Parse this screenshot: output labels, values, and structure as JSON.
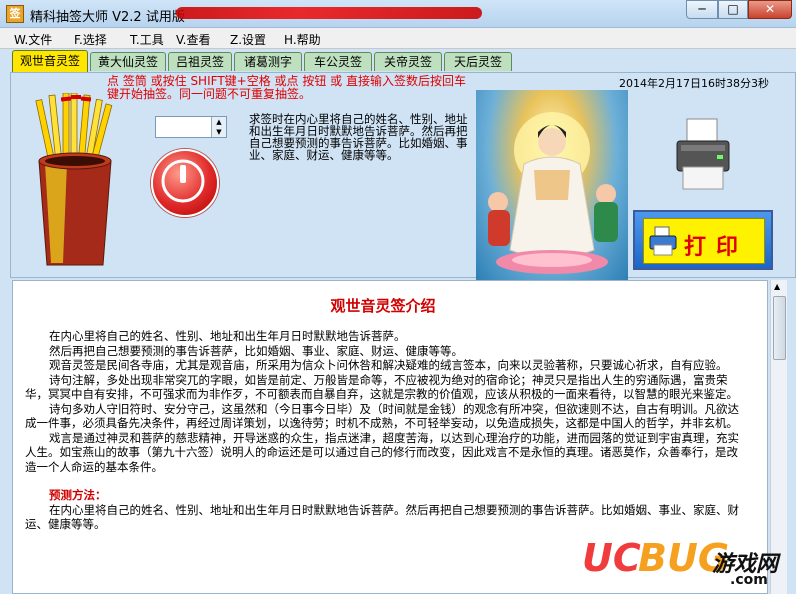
{
  "window": {
    "icon_text": "签",
    "title": "精科抽签大师   V2.2 试用版",
    "controls": {
      "minimize": "─",
      "maximize": "□",
      "close": "✕"
    }
  },
  "menu": [
    "W.文件",
    "F.选择",
    "T.工具",
    "V.查看",
    "Z.设置",
    "H.帮助"
  ],
  "tabs": [
    "观世音灵签",
    "黄大仙灵签",
    "吕祖灵签",
    "诸葛测字",
    "车公灵签",
    "关帝灵签",
    "天后灵签"
  ],
  "top": {
    "instructions": "点 签筒 或按住 SHIFT键+空格 或点 按钮 或 直接输入签数后按回车键开始抽签。同一问题不可重复抽签。",
    "datetime": "2014年2月17日16时38分3秒",
    "spin_value": "",
    "description": "求签时在内心里将自己的姓名、性别、地址和出生年月日时默默地告诉菩萨。然后再把自己想要预测的事告诉菩萨。比如婚姻、事业、家庭、财运、健康等等。",
    "print_label": "打印"
  },
  "article": {
    "title": "观世音灵签介绍",
    "paragraphs": [
      "在内心里将自己的姓名、性别、地址和出生年月日时默默地告诉菩萨。",
      "然后再把自己想要预测的事告诉菩萨，比如婚姻、事业、家庭、财运、健康等等。",
      "观音灵签是民间各寺庙，尤其是观音庙，所采用为信众卜问休咎和解决疑难的绒言签本，向来以灵验著称，只要诚心祈求，自有应验。",
      "诗句注解，多处出现非常突兀的字眼，如皆是前定、万般皆是命等，不应被视为绝对的宿命论；神灵只是指出人生的穷通际遇，富贵荣华，冥冥中自有安排，不可强求而为非作歹，不可额表而自暴自弃，这就是宗教的价值观，应该从积极的一面来看待，以智慧的眼光来鉴定。",
      "诗句多劝人守旧符时、安分守己，这虽然和（今日事今日毕）及（时间就是金钱）的观念有所冲突，但欲速则不达，自古有明训。凡欲达成一件事，必须具备先决条件，再经过周详策划，以逸待劳；时机不成熟，不可轻举妄动，以免造成损失，这都是中国人的哲学，并非玄机。",
      "戏言是通过神灵和菩萨的慈悲精神，开导迷惑的众生，指点迷津，超度苦海，以达到心理治疗的功能，进而园落的觉证到宇宙真理，充实人生。如宝燕山的故事（第九十六签）说明人的命运还是可以通过自己的修行而改变，因此戏言不是永恒的真理。诸恶莫作，众善奉行，是改造一个人命运的基本条件。"
    ],
    "method_heading": "预测方法：",
    "method_text": "在内心里将自己的姓名、性别、地址和出生年月日时默默地告诉菩萨。然后再把自己想要预测的事告诉菩萨。比如婚姻、事业、家庭、财运、健康等等。"
  },
  "watermark": {
    "uc": "UC",
    "bug": "BUG",
    "cn": "游戏网",
    "com": ".com"
  },
  "colors": {
    "accent_red": "#e00000",
    "tab_active": "#ffe600",
    "tab_inactive": "#bfe0bf",
    "panel_bg": "#cfe3f5"
  }
}
